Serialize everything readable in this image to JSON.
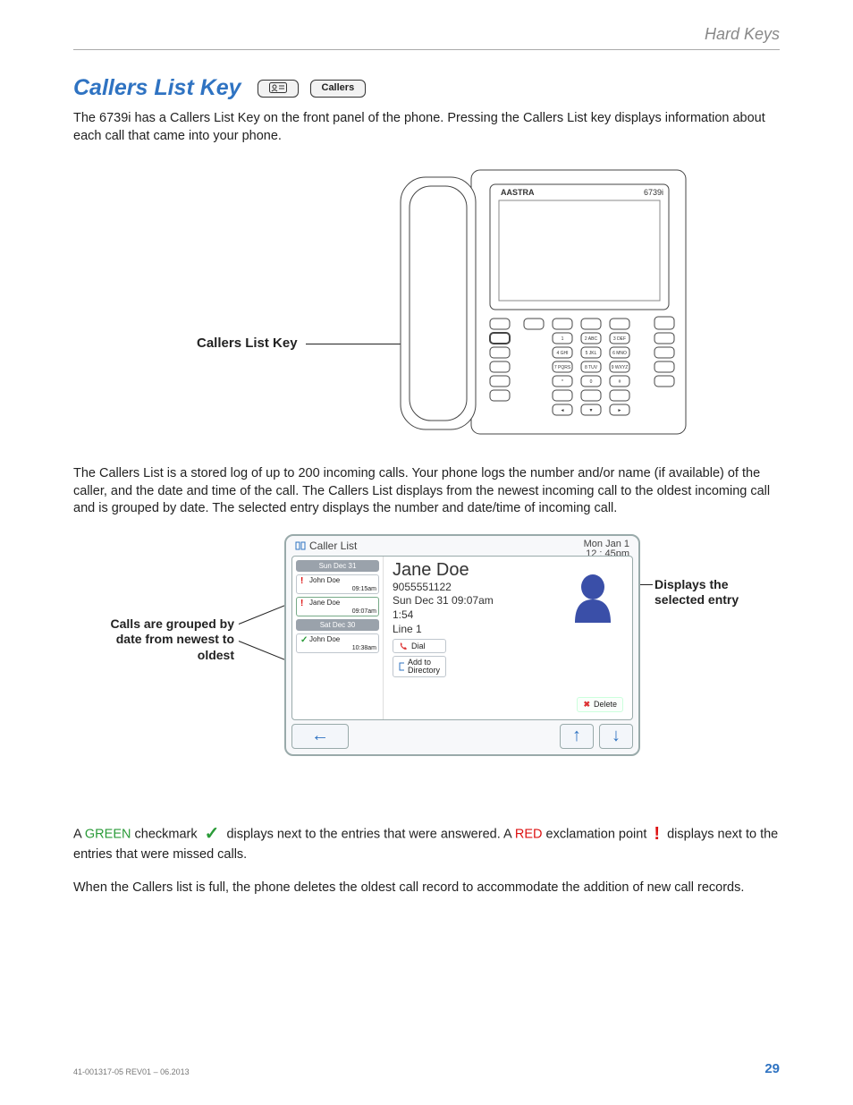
{
  "header": {
    "section": "Hard Keys"
  },
  "title": "Callers List Key",
  "chips": {
    "second": "Callers"
  },
  "intro": "The 6739i has a Callers List Key on the front panel of the phone. Pressing the Callers List key displays information about each call that came into your phone.",
  "phone": {
    "label": "Callers List Key",
    "brand": "AASTRA",
    "model": "6739i"
  },
  "para2": "The Callers List is a stored log of up to 200 incoming calls. Your phone logs the number and/or name (if available) of the caller, and the date and time of the call. The Callers List displays from the newest incoming call to the oldest incoming call and is grouped by date. The selected entry displays the number and date/time of incoming call.",
  "screen": {
    "title": "Caller List",
    "clock_line1": "Mon Jan 1",
    "clock_line2": "12 : 45pm",
    "groups": [
      {
        "date": "Sun Dec 31",
        "items": [
          {
            "status": "missed",
            "name": "John Doe",
            "time": "09:15am"
          },
          {
            "status": "missed",
            "name": "Jane Doe",
            "time": "09:07am"
          }
        ]
      },
      {
        "date": "Sat Dec 30",
        "items": [
          {
            "status": "answered",
            "name": "John Doe",
            "time": "10:38am"
          }
        ]
      }
    ],
    "detail": {
      "name": "Jane Doe",
      "number": "9055551122",
      "date": "Sun Dec 31 09:07am",
      "duration": "1:54",
      "line": "Line 1",
      "dial": "Dial",
      "add": "Add to\nDirectory",
      "delete": "Delete"
    }
  },
  "callouts": {
    "left": "Calls are grouped by date from newest to oldest",
    "right": "Displays the selected entry"
  },
  "legend": {
    "pre": "A ",
    "green": "GREEN",
    "mid1": " checkmark ",
    "mid2": " displays next to the entries that were answered. A ",
    "red": "RED",
    "mid3": " exclamation point ",
    "mid4": " displays next to the entries that were missed calls."
  },
  "para_last": "When the Callers list is full, the phone deletes the oldest call record to accommodate the addition of new call records.",
  "footer": {
    "doc": "41-001317-05 REV01 – 06.2013",
    "page": "29"
  }
}
